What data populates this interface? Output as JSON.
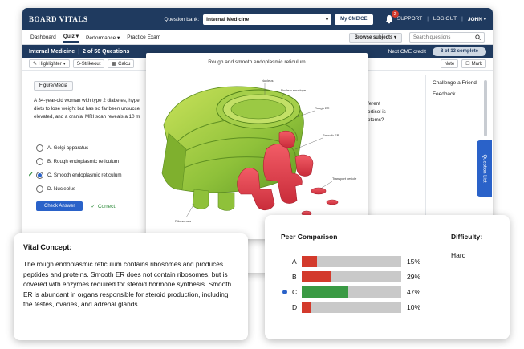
{
  "header": {
    "logo": "BOARD VITALS",
    "qbank_label": "Question bank:",
    "qbank_value": "Internal Medicine",
    "cme_button": "My CME/CE",
    "notification_count": "2",
    "links": [
      "SUPPORT",
      "LOG OUT",
      "JOHN"
    ]
  },
  "nav": {
    "items": [
      "Dashboard",
      "Quiz",
      "Performance",
      "Practice Exam"
    ],
    "browse_button": "Browse subjects",
    "search_placeholder": "Search questions"
  },
  "question_header": {
    "subject": "Internal Medicine",
    "progress": "2 of 50 Questions",
    "credit": "Next CME credit",
    "complete": "8 of 13 complete"
  },
  "toolbar": {
    "highlighter": "Highlighter",
    "strikeout": "Strikeout",
    "calculator": "Calcu",
    "note": "Note",
    "mark": "Mark"
  },
  "question": {
    "figure_button": "Figure/Media",
    "text_lines": [
      "A 34-year-old woman with type 2 diabetes, hype",
      "diets to lose weight but has so far been unsucce",
      "elevated, and a cranial MRI scan reveals a 10 m"
    ],
    "text_right_lines": [
      "ferent",
      "ortisol is",
      "ptoms?"
    ],
    "answers": [
      {
        "label": "A. Golgi apparatus",
        "selected": false,
        "correct": false
      },
      {
        "label": "B. Rough endoplasmic reticulum",
        "selected": false,
        "correct": false
      },
      {
        "label": "C. Smooth endoplasmic reticulum",
        "selected": true,
        "correct": true
      },
      {
        "label": "D. Nucleolus",
        "selected": false,
        "correct": false
      }
    ],
    "check_button": "Check Answer",
    "result": "Correct."
  },
  "sidepanel": {
    "items": [
      "Challenge a Friend",
      "Feedback"
    ],
    "question_list_tab": "Question List"
  },
  "figure": {
    "title": "Rough and smooth endoplasmic reticulum",
    "labels": [
      "Nucleus",
      "Nuclear envelope",
      "Rough ER",
      "Smooth ER",
      "Transport vesicle",
      "Ribosomes"
    ]
  },
  "vital": {
    "title": "Vital Concept:",
    "text": "The rough endoplasmic reticulum contains ribosomes and produces peptides and proteins. Smooth ER does not contain ribosomes, but is covered with enzymes required for steroid hormone synthesis. Smooth ER is abundant in organs responsible for steroid production, including the testes, ovaries, and adrenal glands."
  },
  "peer": {
    "title": "Peer Comparison",
    "difficulty_title": "Difficulty:",
    "difficulty_value": "Hard",
    "rows": [
      {
        "letter": "A",
        "pct": "15%",
        "value": 0.15,
        "color": "#d33a2c",
        "selected": false
      },
      {
        "letter": "B",
        "pct": "29%",
        "value": 0.29,
        "color": "#d33a2c",
        "selected": false
      },
      {
        "letter": "C",
        "pct": "47%",
        "value": 0.47,
        "color": "#3a9a44",
        "selected": true
      },
      {
        "letter": "D",
        "pct": "10%",
        "value": 0.1,
        "color": "#d33a2c",
        "selected": false
      }
    ]
  },
  "colors": {
    "brand_navy": "#1f3a5f",
    "accent_blue": "#2a62c9",
    "correct_green": "#3a9a44",
    "wrong_red": "#d33a2c"
  }
}
